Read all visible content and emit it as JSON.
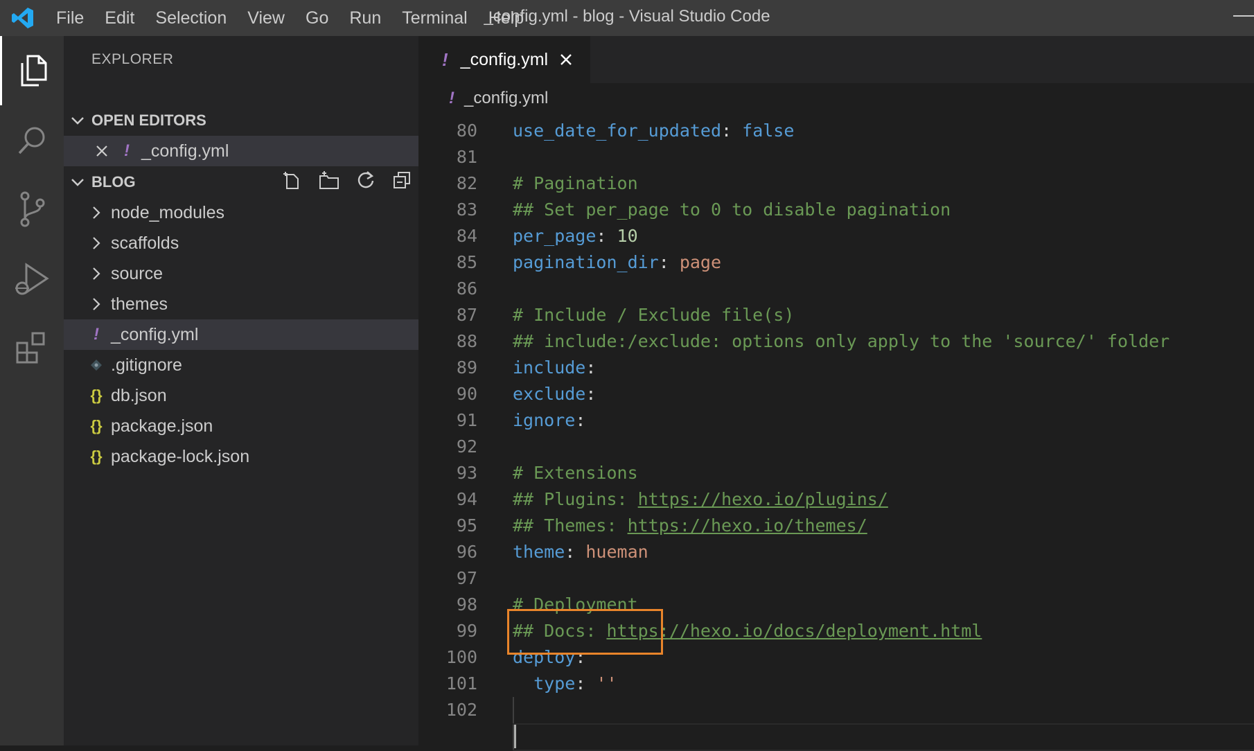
{
  "titlebar": {
    "menu": [
      "File",
      "Edit",
      "Selection",
      "View",
      "Go",
      "Run",
      "Terminal",
      "Help"
    ],
    "window_title": "_config.yml - blog - Visual Studio Code"
  },
  "activitybar": {
    "items": [
      "explorer-icon",
      "search-icon",
      "source-control-icon",
      "run-debug-icon",
      "extensions-icon"
    ]
  },
  "sidebar": {
    "title": "EXPLORER",
    "open_editors": {
      "label": "OPEN EDITORS",
      "items": [
        {
          "name": "_config.yml"
        }
      ]
    },
    "project": {
      "label": "BLOG",
      "folders": [
        "node_modules",
        "scaffolds",
        "source",
        "themes"
      ],
      "files": [
        {
          "name": "_config.yml",
          "type": "yml"
        },
        {
          "name": ".gitignore",
          "type": "git"
        },
        {
          "name": "db.json",
          "type": "json"
        },
        {
          "name": "package.json",
          "type": "json"
        },
        {
          "name": "package-lock.json",
          "type": "json"
        }
      ]
    }
  },
  "editor": {
    "tab_label": "_config.yml",
    "breadcrumb": "_config.yml",
    "lines": [
      {
        "n": "80",
        "tokens": [
          [
            "k",
            "use_date_for_updated"
          ],
          [
            "p",
            ": "
          ],
          [
            "b",
            "false"
          ]
        ]
      },
      {
        "n": "81",
        "tokens": []
      },
      {
        "n": "82",
        "tokens": [
          [
            "c",
            "# Pagination"
          ]
        ]
      },
      {
        "n": "83",
        "tokens": [
          [
            "c",
            "## Set per_page to 0 to disable pagination"
          ]
        ]
      },
      {
        "n": "84",
        "tokens": [
          [
            "k",
            "per_page"
          ],
          [
            "p",
            ": "
          ],
          [
            "n",
            "10"
          ]
        ]
      },
      {
        "n": "85",
        "tokens": [
          [
            "k",
            "pagination_dir"
          ],
          [
            "p",
            ": "
          ],
          [
            "s",
            "page"
          ]
        ]
      },
      {
        "n": "86",
        "tokens": []
      },
      {
        "n": "87",
        "tokens": [
          [
            "c",
            "# Include / Exclude file(s)"
          ]
        ]
      },
      {
        "n": "88",
        "tokens": [
          [
            "c",
            "## include:/exclude: options only apply to the 'source/' folder"
          ]
        ]
      },
      {
        "n": "89",
        "tokens": [
          [
            "k",
            "include"
          ],
          [
            "p",
            ":"
          ]
        ]
      },
      {
        "n": "90",
        "tokens": [
          [
            "k",
            "exclude"
          ],
          [
            "p",
            ":"
          ]
        ]
      },
      {
        "n": "91",
        "tokens": [
          [
            "k",
            "ignore"
          ],
          [
            "p",
            ":"
          ]
        ]
      },
      {
        "n": "92",
        "tokens": []
      },
      {
        "n": "93",
        "tokens": [
          [
            "c",
            "# Extensions"
          ]
        ]
      },
      {
        "n": "94",
        "tokens": [
          [
            "c",
            "## Plugins: "
          ],
          [
            "cu",
            "https://hexo.io/plugins/"
          ]
        ]
      },
      {
        "n": "95",
        "tokens": [
          [
            "c",
            "## Themes: "
          ],
          [
            "cu",
            "https://hexo.io/themes/"
          ]
        ]
      },
      {
        "n": "96",
        "tokens": [
          [
            "k",
            "theme"
          ],
          [
            "p",
            ": "
          ],
          [
            "s",
            "hueman"
          ]
        ]
      },
      {
        "n": "97",
        "tokens": []
      },
      {
        "n": "98",
        "tokens": [
          [
            "c",
            "# Deployment"
          ]
        ]
      },
      {
        "n": "99",
        "tokens": [
          [
            "c",
            "## Docs: "
          ],
          [
            "cu",
            "https://hexo.io/docs/deployment.html"
          ]
        ]
      },
      {
        "n": "100",
        "tokens": [
          [
            "k",
            "deploy"
          ],
          [
            "p",
            ":"
          ]
        ]
      },
      {
        "n": "101",
        "tokens": [
          [
            "p",
            "  "
          ],
          [
            "k",
            "type"
          ],
          [
            "p",
            ": "
          ],
          [
            "s",
            "''"
          ]
        ]
      },
      {
        "n": "102",
        "tokens": []
      }
    ]
  },
  "colors": {
    "accent": "#007acc",
    "highlight": "#e8842a",
    "yml_icon": "#a074c4",
    "json_icon": "#cbcb41"
  }
}
